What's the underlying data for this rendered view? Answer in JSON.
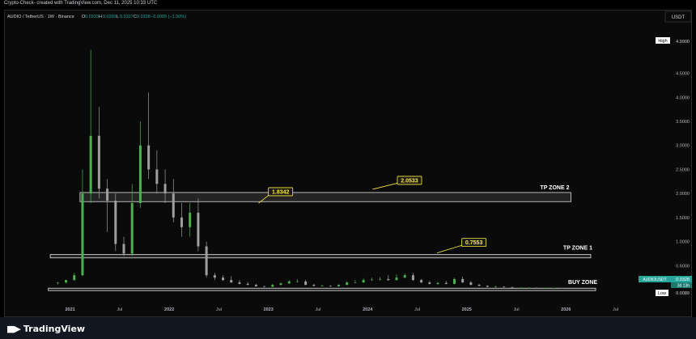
{
  "header": {
    "attribution": "Crypto-Check- created with TradingView.com, Dec 11, 2025 10:33 UTC"
  },
  "branding": {
    "logo_icon": "tradingview-logo-icon",
    "name": "TradingView"
  },
  "symbol": {
    "title": "AUDIO / TetherUS · 1W · Binance",
    "o_label": "O",
    "o": "0.0333",
    "h_label": "H",
    "h": "0.0393",
    "l_label": "L",
    "l": "0.0327",
    "c_label": "C",
    "c": "0.0328",
    "change": "−0.0005 (−1.50%)"
  },
  "price_axis": {
    "currency": "USDT",
    "high_label": "High",
    "high_value": "4.9900",
    "low_label": "Low",
    "low_value": "0.0089",
    "last_symbol": "AUDIOUSDT",
    "last_value": "0.0328",
    "countdown": "3d 13h"
  },
  "colors": {
    "up": "#26a69a",
    "bar_up": "#4caf50",
    "bar_down": "#9e9e9e",
    "label_fill": "#ffeb3b",
    "zone_fill": "#3a3a3a"
  },
  "chart_data": {
    "type": "candlestick",
    "interval": "1W",
    "yticks": [
      "0.5000",
      "1.0000",
      "1.5000",
      "2.0000",
      "2.5000",
      "3.0000",
      "3.5000",
      "4.0000",
      "4.5000"
    ],
    "xticks": [
      "2021",
      "Jul",
      "2022",
      "Jul",
      "2023",
      "Jul",
      "2024",
      "Jul",
      "2025",
      "Jul",
      "2026",
      "Jul"
    ],
    "ylim": [
      0,
      5.3
    ],
    "grid": false,
    "zones": [
      {
        "name": "TP ZONE 2",
        "low": 1.83,
        "high": 2.02,
        "label_value": "2.0533",
        "label_value_2": "1.8342"
      },
      {
        "name": "TP ZONE 1",
        "low": 0.66,
        "high": 0.73,
        "label_value": "0.7553"
      },
      {
        "name": "BUY ZONE",
        "low": 0.005,
        "high": 0.03
      }
    ],
    "series": [
      {
        "x": [
          "2020-11",
          "2020-12",
          "2021-01",
          "2021-02",
          "2021-03",
          "2021-04",
          "2021-05",
          "2021-06",
          "2021-07",
          "2021-08",
          "2021-09",
          "2021-10",
          "2021-11",
          "2021-12",
          "2022-01",
          "2022-02",
          "2022-03",
          "2022-04",
          "2022-05",
          "2022-06",
          "2022-07",
          "2022-08",
          "2022-09",
          "2022-10",
          "2022-11",
          "2022-12",
          "2023-01",
          "2023-02",
          "2023-03",
          "2023-04",
          "2023-05",
          "2023-06",
          "2023-07",
          "2023-08",
          "2023-09",
          "2023-10",
          "2023-11",
          "2023-12",
          "2024-01",
          "2024-02",
          "2024-03",
          "2024-04",
          "2024-05",
          "2024-06",
          "2024-07",
          "2024-08",
          "2024-09",
          "2024-10",
          "2024-11",
          "2024-12",
          "2025-01",
          "2025-02",
          "2025-03",
          "2025-04",
          "2025-05",
          "2025-06",
          "2025-07",
          "2025-08",
          "2025-09",
          "2025-10",
          "2025-11",
          "2025-12"
        ],
        "open": [
          0.14,
          0.15,
          0.2,
          0.3,
          2.0,
          3.2,
          2.1,
          1.85,
          0.95,
          0.75,
          1.8,
          3.0,
          2.5,
          2.2,
          2.0,
          1.5,
          1.3,
          1.6,
          0.9,
          0.3,
          0.25,
          0.2,
          0.15,
          0.12,
          0.1,
          0.07,
          0.06,
          0.1,
          0.13,
          0.17,
          0.17,
          0.1,
          0.08,
          0.08,
          0.07,
          0.1,
          0.15,
          0.15,
          0.2,
          0.21,
          0.22,
          0.2,
          0.25,
          0.3,
          0.2,
          0.15,
          0.12,
          0.14,
          0.12,
          0.22,
          0.15,
          0.1,
          0.08,
          0.06,
          0.06,
          0.05,
          0.04,
          0.04,
          0.04,
          0.03,
          0.03,
          0.033
        ],
        "high": [
          0.16,
          0.18,
          0.35,
          2.5,
          4.99,
          3.8,
          2.3,
          2.0,
          1.1,
          2.2,
          3.5,
          4.1,
          2.9,
          2.5,
          2.3,
          1.8,
          1.8,
          1.9,
          1.0,
          0.35,
          0.3,
          0.28,
          0.2,
          0.16,
          0.12,
          0.08,
          0.12,
          0.15,
          0.2,
          0.22,
          0.2,
          0.12,
          0.1,
          0.09,
          0.11,
          0.17,
          0.2,
          0.24,
          0.25,
          0.26,
          0.3,
          0.32,
          0.34,
          0.35,
          0.22,
          0.18,
          0.16,
          0.18,
          0.25,
          0.27,
          0.18,
          0.12,
          0.09,
          0.08,
          0.07,
          0.06,
          0.05,
          0.05,
          0.045,
          0.04,
          0.035,
          0.0393
        ],
        "low": [
          0.1,
          0.13,
          0.18,
          0.28,
          1.8,
          1.9,
          1.2,
          0.8,
          0.7,
          0.7,
          1.7,
          2.3,
          2.0,
          1.8,
          1.4,
          1.1,
          1.1,
          0.8,
          0.25,
          0.2,
          0.18,
          0.14,
          0.11,
          0.09,
          0.06,
          0.05,
          0.055,
          0.09,
          0.12,
          0.15,
          0.09,
          0.07,
          0.07,
          0.06,
          0.065,
          0.09,
          0.14,
          0.14,
          0.18,
          0.19,
          0.18,
          0.19,
          0.24,
          0.18,
          0.14,
          0.11,
          0.1,
          0.11,
          0.11,
          0.14,
          0.09,
          0.07,
          0.05,
          0.05,
          0.045,
          0.035,
          0.035,
          0.035,
          0.028,
          0.025,
          0.0089,
          0.0327
        ],
        "close": [
          0.15,
          0.2,
          0.3,
          2.0,
          3.2,
          2.1,
          1.85,
          0.95,
          0.75,
          1.8,
          3.0,
          2.5,
          2.2,
          2.0,
          1.5,
          1.3,
          1.6,
          0.9,
          0.3,
          0.25,
          0.2,
          0.15,
          0.12,
          0.1,
          0.07,
          0.06,
          0.1,
          0.13,
          0.17,
          0.17,
          0.1,
          0.08,
          0.08,
          0.07,
          0.1,
          0.15,
          0.15,
          0.2,
          0.21,
          0.22,
          0.2,
          0.25,
          0.3,
          0.2,
          0.15,
          0.12,
          0.14,
          0.12,
          0.22,
          0.15,
          0.1,
          0.08,
          0.06,
          0.06,
          0.05,
          0.04,
          0.04,
          0.04,
          0.03,
          0.03,
          0.033,
          0.0328
        ]
      }
    ]
  }
}
